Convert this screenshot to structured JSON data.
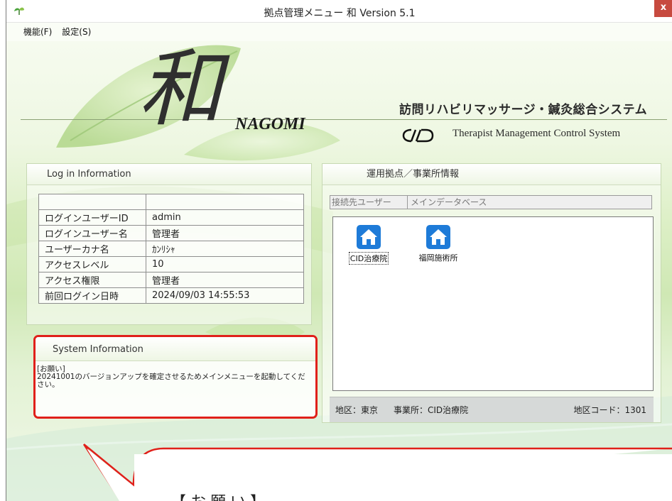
{
  "window": {
    "title": "拠点管理メニュー 和 Version 5.1",
    "close_label": "x"
  },
  "menu": {
    "items": [
      "機能(F)",
      "設定(S)"
    ]
  },
  "header": {
    "logo_kanji": "和",
    "logo_text": "NAGOMI",
    "system_title": "訪問リハビリマッサージ・鍼灸総合システム",
    "system_subtitle": "Therapist Management Control System"
  },
  "login_panel": {
    "title": "Log in Information",
    "rows": [
      {
        "key": "ログインユーザーID",
        "value": "admin"
      },
      {
        "key": "ログインユーザー名",
        "value": "管理者"
      },
      {
        "key": "ユーザーカナ名",
        "value": "ｶﾝﾘｼｬ"
      },
      {
        "key": "アクセスレベル",
        "value": "10"
      },
      {
        "key": "アクセス権限",
        "value": "管理者"
      },
      {
        "key": "前回ログイン日時",
        "value": "2024/09/03 14:55:53"
      }
    ]
  },
  "system_panel": {
    "title": "System Information",
    "message": "[お願い]\n20241001のバージョンアップを確定させるためメインメニューを起動してください。"
  },
  "sites_panel": {
    "title": "運用拠点／事業所情報",
    "connection_label": "接続先ユーザー",
    "connection_value": "メインデータベース",
    "sites": [
      {
        "name": "CID治療院",
        "selected": true
      },
      {
        "name": "福岡施術所",
        "selected": false
      }
    ],
    "status": {
      "area": "地区：東京",
      "office": "事業所：CID治療院",
      "area_code": "地区コード：1301"
    }
  },
  "callout": {
    "text": "【お願い】"
  },
  "colors": {
    "highlight_border": "#e0201a",
    "site_icon": "#1e7bd8",
    "close_button": "#c74a3f"
  },
  "icons": {
    "app": "leaf-app-icon",
    "site": "house-icon",
    "brand": "cid-logo-icon"
  }
}
